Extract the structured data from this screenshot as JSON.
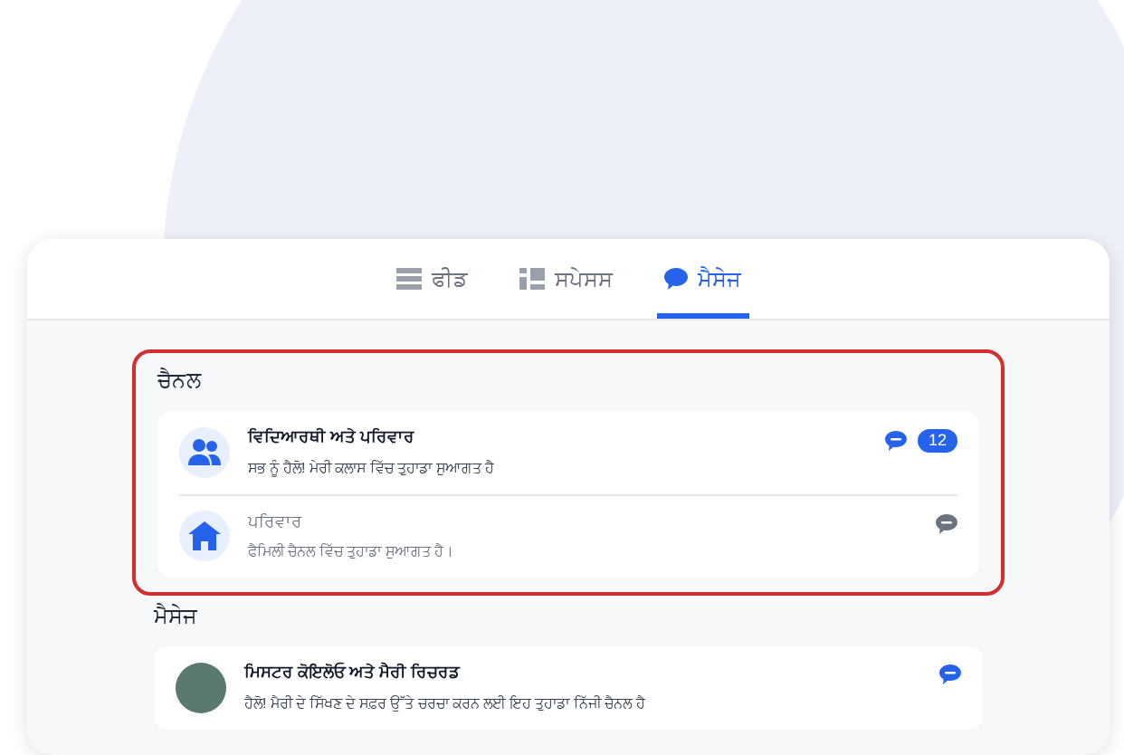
{
  "tabs": [
    {
      "label": "ਫੀਡ",
      "selected": false
    },
    {
      "label": "ਸਪੇਸਸ",
      "selected": false
    },
    {
      "label": "ਮੈਸੇਜ",
      "selected": true
    }
  ],
  "channels": {
    "heading": "ਚੈਨਲ",
    "highlighted": true,
    "items": [
      {
        "title": "ਵਿਦਿਆਰਥੀ ਅਤੇ ਪਰਿਵਾਰ",
        "preview": "ਸਭ ਨੂੰ ਹੈਲੋ! ਮੇਰੀ ਕਲਾਸ ਵਿੱਚ ਤੁਹਾਡਾ ਸੁਆਗਤ ਹੈ",
        "unread": true,
        "count": "12"
      },
      {
        "title": "ਪਰਿਵਾਰ",
        "preview": "ਫੈਮਿਲੀ ਚੈਨਲ ਵਿੱਚ ਤੁਹਾਡਾ ਸੁਆਗਤ ਹੈ।",
        "unread": false
      }
    ]
  },
  "messages": {
    "heading": "ਮੈਸੇਜ",
    "items": [
      {
        "title": "ਮਿਸਟਰ ਕੋਇਲੋਓ ਅਤੇ ਮੈਰੀ ਰਿਚਰਡ",
        "preview": "ਹੈਲੋ! ਮੈਰੀ ਦੇ ਸਿੱਖਣ ਦੇ ਸਫ਼ਰ ਉੱਤੇ ਚਰਚਾ ਕਰਨ ਲਈ ਇਹ ਤੁਹਾਡਾ ਨਿੱਜੀ ਚੈਨਲ ਹੈ",
        "unread": true
      }
    ]
  }
}
